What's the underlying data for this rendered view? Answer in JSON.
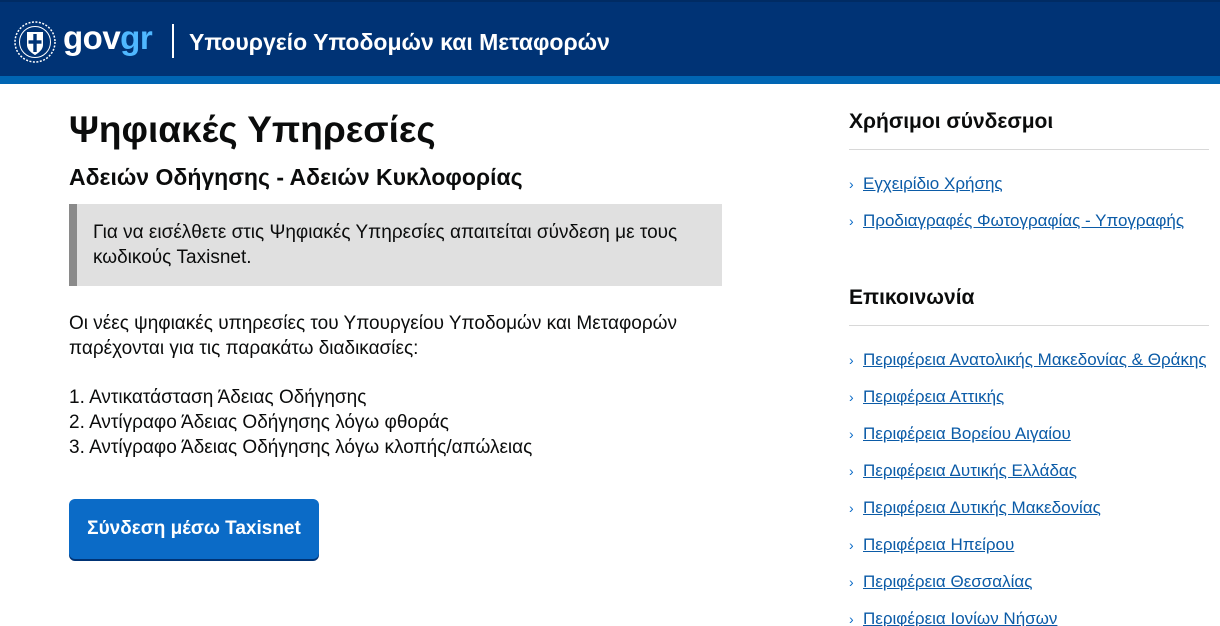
{
  "header": {
    "logo_gov": "gov",
    "logo_gr": "gr",
    "ministry": "Υπουργείο Υποδομών και Μεταφορών",
    "emblem_icon": "greek-coat-of-arms-icon"
  },
  "main": {
    "title": "Ψηφιακές Υπηρεσίες",
    "subtitle": "Αδειών Οδήγησης - Αδειών Κυκλοφορίας",
    "notice": "Για να εισέλθετε στις Ψηφιακές Υπηρεσίες απαιτείται σύνδεση με τους κωδικούς Taxisnet.",
    "intro": "Οι νέες ψηφιακές υπηρεσίες του Υπουργείου Υποδομών και Μεταφορών παρέχονται για τις παρακάτω διαδικασίες:",
    "procedures": [
      "1. Αντικατάσταση Άδειας Οδήγησης",
      "2. Αντίγραφο Άδειας Οδήγησης λόγω φθοράς",
      "3. Αντίγραφο Άδειας Οδήγησης λόγω κλοπής/απώλειας"
    ],
    "login_button": "Σύνδεση μέσω Taxisnet"
  },
  "aside": {
    "useful_links_title": "Χρήσιμοι σύνδεσμοι",
    "useful_links": [
      "Εγχειρίδιο Χρήσης",
      "Προδιαγραφές Φωτογραφίας - Υπογραφής"
    ],
    "contact_title": "Επικοινωνία",
    "contact_links": [
      "Περιφέρεια Ανατολικής Μακεδονίας & Θράκης",
      "Περιφέρεια Αττικής",
      "Περιφέρεια Βορείου Αιγαίου",
      "Περιφέρεια Δυτικής Ελλάδας",
      "Περιφέρεια Δυτικής Μακεδονίας",
      "Περιφέρεια Ηπείρου",
      "Περιφέρεια Θεσσαλίας",
      "Περιφέρεια Ιονίων Νήσων"
    ],
    "chevron_icon": "chevron-right-icon"
  },
  "colors": {
    "header_bg": "#003375",
    "header_stripe": "#0065b3",
    "link": "#0b5ba7",
    "button_bg": "#0b6bc7",
    "notice_bg": "#e0e0e0",
    "notice_border": "#8a8a8a"
  }
}
